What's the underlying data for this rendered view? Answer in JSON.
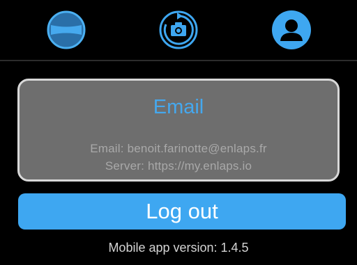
{
  "nav": {
    "items": [
      {
        "icon": "panorama-icon",
        "active": false
      },
      {
        "icon": "camera-rotate-icon",
        "active": false
      },
      {
        "icon": "user-account-icon",
        "active": true
      }
    ],
    "accent_color": "#3ea7f1"
  },
  "account_card": {
    "title": "Email",
    "email_line": "Email: benoit.farinotte@enlaps.fr",
    "server_line": "Server: https://my.enlaps.io"
  },
  "logout_button": {
    "label": "Log out",
    "color": "#3ea7f1"
  },
  "footer": {
    "version_text": "Mobile app version: 1.4.5"
  }
}
